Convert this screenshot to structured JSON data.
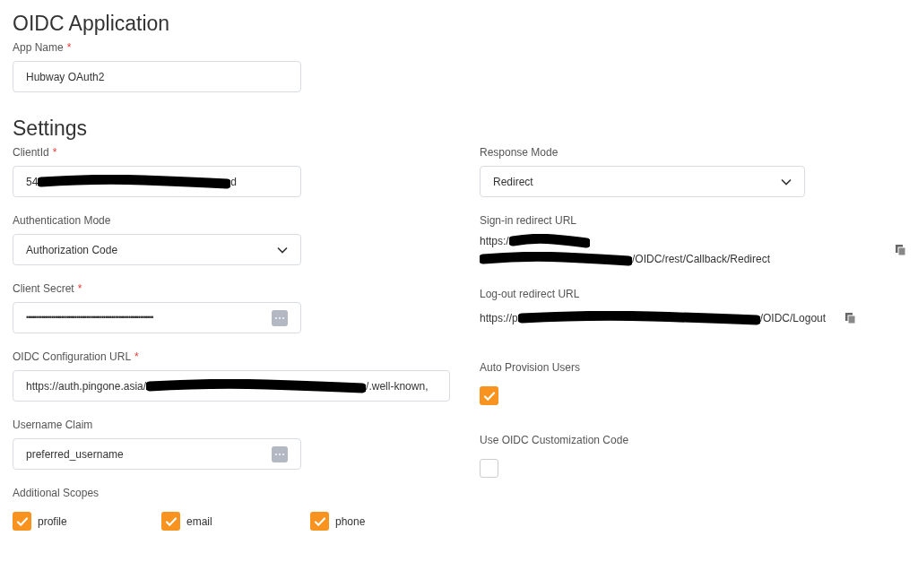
{
  "title": "OIDC Application",
  "app_name": {
    "label": "App Name",
    "required_mark": "*",
    "value": "Hubway OAuth2"
  },
  "settings_title": "Settings",
  "left": [
    {
      "kind": "redacted",
      "label": "ClientId",
      "required_mark": "*",
      "value_start": "54",
      "value_end": "d"
    },
    {
      "kind": "select",
      "label": "Authentication Mode",
      "value": "Authorization Code"
    },
    {
      "kind": "secret",
      "label": "Client Secret",
      "required_mark": "*",
      "value": "••••••••••••••••••••••••••••••••••••••••••••••••••••••••••••••••••"
    },
    {
      "kind": "redacted_wide",
      "label": "OIDC Configuration URL",
      "required_mark": "*",
      "value_start": "https://auth.pingone.asia/",
      "value_end": "/.well-known,"
    },
    {
      "kind": "claim",
      "label": "Username Claim",
      "value": "preferred_username"
    }
  ],
  "additional_scopes": {
    "label": "Additional Scopes",
    "items": [
      {
        "label": "profile",
        "checked": true
      },
      {
        "label": "email",
        "checked": true
      },
      {
        "label": "phone",
        "checked": true
      }
    ]
  },
  "right": [
    {
      "kind": "select",
      "label": "Response Mode",
      "value": "Redirect"
    },
    {
      "kind": "url2",
      "label": "Sign-in redirect URL",
      "value_start": "https:/",
      "value_end": "/OIDC/rest/Callback/Redirect"
    },
    {
      "kind": "url",
      "label": "Log-out redirect URL",
      "value_start": "https://p",
      "value_end": "/OIDC/Logout"
    },
    {
      "kind": "check",
      "label": "Auto Provision Users",
      "checked": true
    },
    {
      "kind": "check",
      "label": "Use OIDC Customization Code",
      "checked": false
    }
  ]
}
